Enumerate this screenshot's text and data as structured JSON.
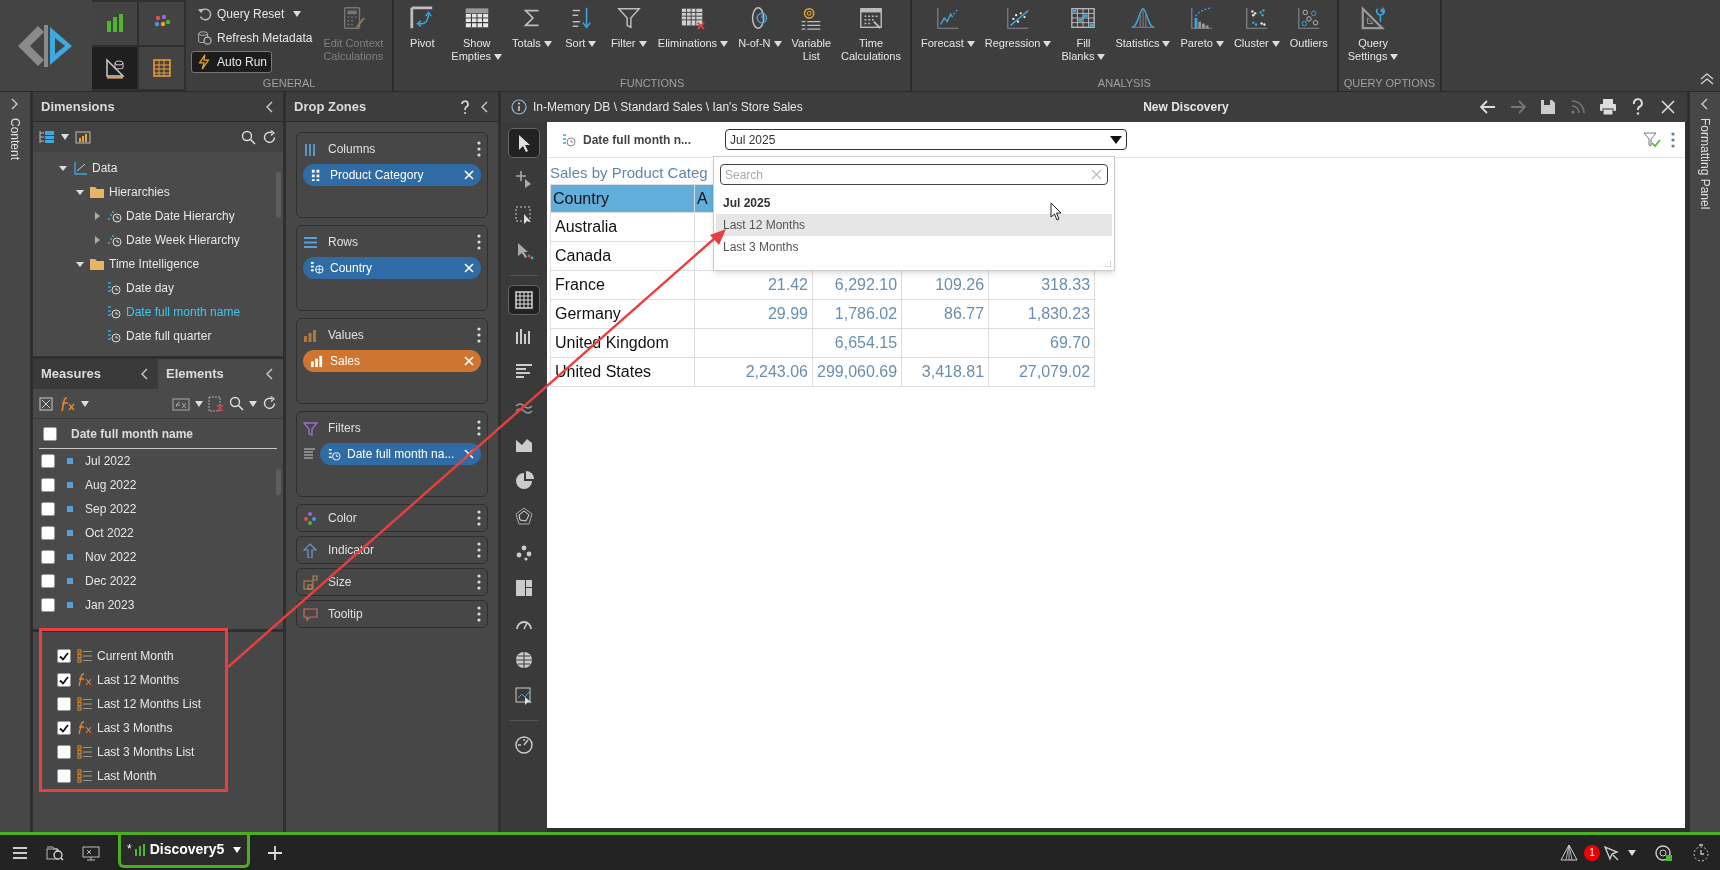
{
  "ribbon": {
    "tiles": [
      {
        "selected": false
      },
      {
        "selected": false
      },
      {
        "selected": true
      },
      {
        "selected": false
      }
    ],
    "groups": [
      {
        "label": "GENERAL",
        "buttons": [
          {
            "label": "Query Reset",
            "kind": "small",
            "dropdown": true,
            "disabled": false,
            "active": false
          },
          {
            "label": "Refresh Metadata",
            "kind": "small",
            "dropdown": false,
            "disabled": false,
            "active": false
          },
          {
            "label": "Auto Run",
            "kind": "small",
            "dropdown": false,
            "disabled": false,
            "active": true
          },
          {
            "label": "Edit Context\nCalculations",
            "kind": "large",
            "dropdown": false,
            "disabled": true,
            "active": false
          }
        ]
      },
      {
        "label": "FUNCTIONS",
        "buttons": [
          {
            "label": "Pivot",
            "kind": "large",
            "dropdown": false,
            "disabled": false,
            "active": false
          },
          {
            "label": "Show\nEmpties",
            "kind": "large",
            "dropdown": true,
            "disabled": false,
            "active": false
          },
          {
            "label": "Totals",
            "kind": "large",
            "dropdown": true,
            "disabled": false,
            "active": false
          },
          {
            "label": "Sort",
            "kind": "large",
            "dropdown": true,
            "disabled": false,
            "active": false
          },
          {
            "label": "Filter",
            "kind": "large",
            "dropdown": true,
            "disabled": false,
            "active": false
          },
          {
            "label": "Eliminations",
            "kind": "large",
            "dropdown": true,
            "disabled": false,
            "active": false
          },
          {
            "label": "N-of-N",
            "kind": "large",
            "dropdown": true,
            "disabled": false,
            "active": false
          },
          {
            "label": "Variable\nList",
            "kind": "large",
            "dropdown": false,
            "disabled": false,
            "active": false
          },
          {
            "label": "Time\nCalculations",
            "kind": "large",
            "dropdown": false,
            "disabled": false,
            "active": false
          }
        ]
      },
      {
        "label": "ANALYSIS",
        "buttons": [
          {
            "label": "Forecast",
            "kind": "large",
            "dropdown": true,
            "disabled": false,
            "active": false
          },
          {
            "label": "Regression",
            "kind": "large",
            "dropdown": true,
            "disabled": false,
            "active": false
          },
          {
            "label": "Fill\nBlanks",
            "kind": "large",
            "dropdown": true,
            "disabled": false,
            "active": false
          },
          {
            "label": "Statistics",
            "kind": "large",
            "dropdown": true,
            "disabled": false,
            "active": false
          },
          {
            "label": "Pareto",
            "kind": "large",
            "dropdown": true,
            "disabled": false,
            "active": false
          },
          {
            "label": "Cluster",
            "kind": "large",
            "dropdown": true,
            "disabled": false,
            "active": false
          },
          {
            "label": "Outliers",
            "kind": "large",
            "dropdown": false,
            "disabled": false,
            "active": false
          }
        ]
      },
      {
        "label": "QUERY OPTIONS",
        "buttons": [
          {
            "label": "Query\nSettings",
            "kind": "large",
            "dropdown": true,
            "disabled": false,
            "active": false
          }
        ]
      }
    ]
  },
  "content_strip": {
    "label": "Content"
  },
  "dimensions": {
    "title": "Dimensions",
    "tree": [
      {
        "label": "Data",
        "kind": "root",
        "expanded": true,
        "selected": false,
        "children": [
          {
            "label": "Hierarchies",
            "kind": "folder",
            "expanded": true,
            "selected": false,
            "children": [
              {
                "label": "Date Date Hierarchy",
                "kind": "hierarchy",
                "expanded": false,
                "selected": false
              },
              {
                "label": "Date Week Hierarchy",
                "kind": "hierarchy",
                "expanded": false,
                "selected": false
              }
            ]
          },
          {
            "label": "Time Intelligence",
            "kind": "folder",
            "expanded": true,
            "selected": false,
            "children": [
              {
                "label": "Date day",
                "kind": "attribute",
                "selected": false
              },
              {
                "label": "Date full month name",
                "kind": "attribute",
                "selected": true
              },
              {
                "label": "Date full quarter",
                "kind": "attribute",
                "selected": false
              }
            ]
          }
        ]
      }
    ]
  },
  "lower_tabs": [
    {
      "label": "Measures",
      "selected": false
    },
    {
      "label": "Elements",
      "selected": true
    }
  ],
  "elements": {
    "header": {
      "label": "Date full month name",
      "checked": false
    },
    "items": [
      {
        "label": "Jul 2022",
        "checked": false
      },
      {
        "label": "Aug 2022",
        "checked": false
      },
      {
        "label": "Sep 2022",
        "checked": false
      },
      {
        "label": "Oct 2022",
        "checked": false
      },
      {
        "label": "Nov 2022",
        "checked": false
      },
      {
        "label": "Dec 2022",
        "checked": false
      },
      {
        "label": "Jan 2023",
        "checked": false
      }
    ]
  },
  "time_intelligence": [
    {
      "label": "Current Month",
      "kind": "list",
      "checked": true
    },
    {
      "label": "Last 12 Months",
      "kind": "formula",
      "checked": true
    },
    {
      "label": "Last 12 Months List",
      "kind": "list",
      "checked": false
    },
    {
      "label": "Last 3 Months",
      "kind": "formula",
      "checked": true
    },
    {
      "label": "Last 3 Months List",
      "kind": "list",
      "checked": false
    },
    {
      "label": "Last Month",
      "kind": "list",
      "checked": false
    }
  ],
  "drop_zones": {
    "title": "Drop Zones",
    "zones": [
      {
        "label": "Columns",
        "kind": "columns",
        "chips": [
          {
            "label": "Product Category",
            "color": "#2f6ca6"
          }
        ]
      },
      {
        "label": "Rows",
        "kind": "rows",
        "chips": [
          {
            "label": "Country",
            "color": "#2f6ca6"
          }
        ]
      },
      {
        "label": "Values",
        "kind": "values",
        "chips": [
          {
            "label": "Sales",
            "color": "#d07531"
          }
        ]
      },
      {
        "label": "Filters",
        "kind": "filters",
        "chips": [
          {
            "label": "Date full month na...",
            "color": "#2f6ca6"
          }
        ]
      },
      {
        "label": "Color",
        "kind": "color"
      },
      {
        "label": "Indicator",
        "kind": "indicator"
      },
      {
        "label": "Size",
        "kind": "size"
      },
      {
        "label": "Tooltip",
        "kind": "tooltip"
      }
    ]
  },
  "view": {
    "breadcrumb": "In-Memory DB \\ Standard Sales \\ Ian's Store Sales",
    "title": "New Discovery",
    "tools": [
      {
        "selected": true
      },
      {
        "selected": false
      },
      {
        "selected": false
      },
      {
        "selected": false
      },
      {
        "selected": true
      },
      {
        "selected": false
      },
      {
        "selected": false
      },
      {
        "selected": false
      },
      {
        "selected": false
      },
      {
        "selected": false
      },
      {
        "selected": false
      },
      {
        "selected": false
      },
      {
        "selected": false
      },
      {
        "selected": false
      },
      {
        "selected": false
      },
      {
        "selected": false
      },
      {
        "selected": false
      }
    ],
    "filter": {
      "label": "Date full month n...",
      "value": "Jul 2025",
      "popup": {
        "placeholder": "Search",
        "options": [
          {
            "label": "Jul 2025",
            "selected": true,
            "highlighted": false
          },
          {
            "label": "Last 12 Months",
            "selected": false,
            "highlighted": true
          },
          {
            "label": "Last 3 Months",
            "selected": false,
            "highlighted": false
          }
        ]
      }
    },
    "table": {
      "title": "Sales by Product Categ",
      "columns": [
        "Country",
        "A"
      ],
      "rows": [
        {
          "cells": [
            "Australia"
          ]
        },
        {
          "cells": [
            "Canada"
          ]
        },
        {
          "cells": [
            "France",
            "21.42",
            "6,292.10",
            "109.26",
            "318.33"
          ]
        },
        {
          "cells": [
            "Germany",
            "29.99",
            "1,786.02",
            "86.77",
            "1,830.23"
          ]
        },
        {
          "cells": [
            "United Kingdom",
            "",
            "6,654.15",
            "",
            "69.70"
          ]
        },
        {
          "cells": [
            "United States",
            "2,243.06",
            "299,060.69",
            "3,418.81",
            "27,079.02"
          ]
        }
      ]
    }
  },
  "formatting_strip": {
    "label": "Formatting Panel"
  },
  "bottom_bar": {
    "tab": {
      "mark": "*",
      "label": "Discovery5",
      "selected": true
    },
    "badge": "1"
  }
}
